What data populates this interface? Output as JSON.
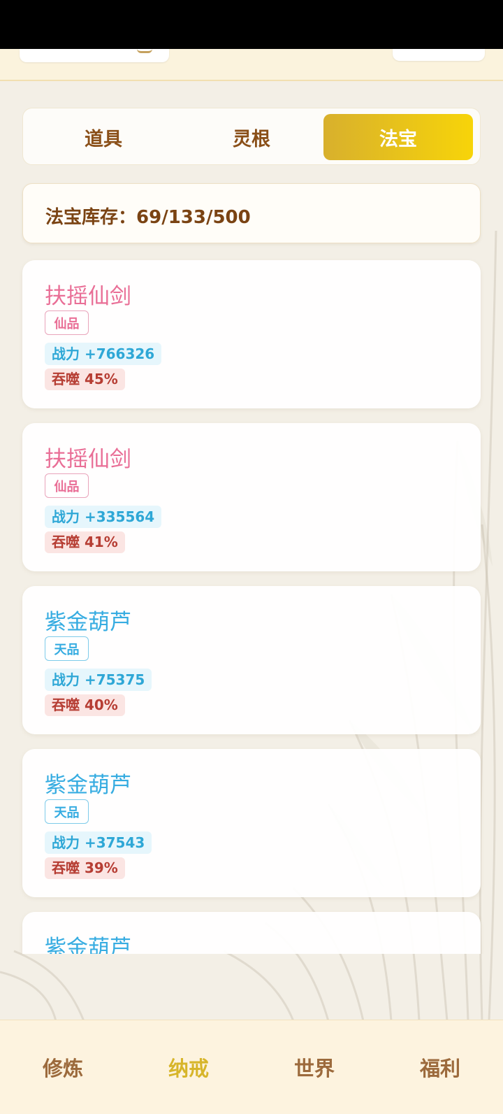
{
  "tabs": [
    {
      "label": "道具",
      "active": false
    },
    {
      "label": "灵根",
      "active": false
    },
    {
      "label": "法宝",
      "active": true
    }
  ],
  "stock": {
    "label": "法宝库存：",
    "value": "69/133/500"
  },
  "items": [
    {
      "name": "扶摇仙剑",
      "grade": "仙品",
      "power": "战力 +766326",
      "devour": "吞噬 45%"
    },
    {
      "name": "扶摇仙剑",
      "grade": "仙品",
      "power": "战力 +335564",
      "devour": "吞噬 41%"
    },
    {
      "name": "紫金葫芦",
      "grade": "天品",
      "power": "战力 +75375",
      "devour": "吞噬 40%"
    },
    {
      "name": "紫金葫芦",
      "grade": "天品",
      "power": "战力 +37543",
      "devour": "吞噬 39%"
    },
    {
      "name": "紫金葫芦"
    }
  ],
  "bottom_nav": [
    {
      "label": "修炼",
      "active": false
    },
    {
      "label": "纳戒",
      "active": true
    },
    {
      "label": "世界",
      "active": false
    },
    {
      "label": "福利",
      "active": false
    }
  ],
  "colors": {
    "accent_gold": "#f7d409",
    "grade_xian": "#e96e96",
    "grade_tian": "#36ace1",
    "power": "#2ea7d6",
    "devour": "#b63d33"
  }
}
